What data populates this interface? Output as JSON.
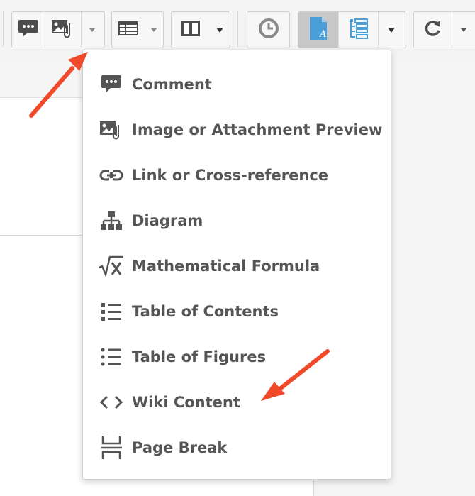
{
  "toolbar": {
    "groups": [
      {
        "name": "comment",
        "icon": "comment-icon"
      },
      {
        "name": "image-attachment",
        "icon": "image-attachment-icon",
        "dropdown": true
      },
      {
        "name": "table",
        "icon": "table-icon",
        "dropdown": true
      },
      {
        "name": "columns",
        "icon": "columns-icon",
        "dropdown": true
      },
      {
        "name": "history",
        "icon": "clock-icon"
      },
      {
        "name": "view-mode",
        "icon": "page-view-icon",
        "active": true
      },
      {
        "name": "outline",
        "icon": "outline-icon",
        "dropdown": true
      },
      {
        "name": "refresh",
        "icon": "refresh-icon",
        "dropdown": true
      }
    ],
    "accent_color": "#4a9fd8"
  },
  "insert_menu": {
    "items": [
      {
        "label": "Comment",
        "icon": "comment-icon"
      },
      {
        "label": "Image or Attachment Preview",
        "icon": "image-attachment-icon"
      },
      {
        "label": "Link or Cross-reference",
        "icon": "link-icon"
      },
      {
        "label": "Diagram",
        "icon": "diagram-icon"
      },
      {
        "label": "Mathematical Formula",
        "icon": "square-root-icon"
      },
      {
        "label": "Table of Contents",
        "icon": "list-icon"
      },
      {
        "label": "Table of Figures",
        "icon": "dotted-list-icon"
      },
      {
        "label": "Wiki Content",
        "icon": "code-brackets-icon"
      },
      {
        "label": "Page Break",
        "icon": "page-break-icon"
      }
    ]
  },
  "annotations": {
    "arrow_color": "#f04a2a"
  }
}
